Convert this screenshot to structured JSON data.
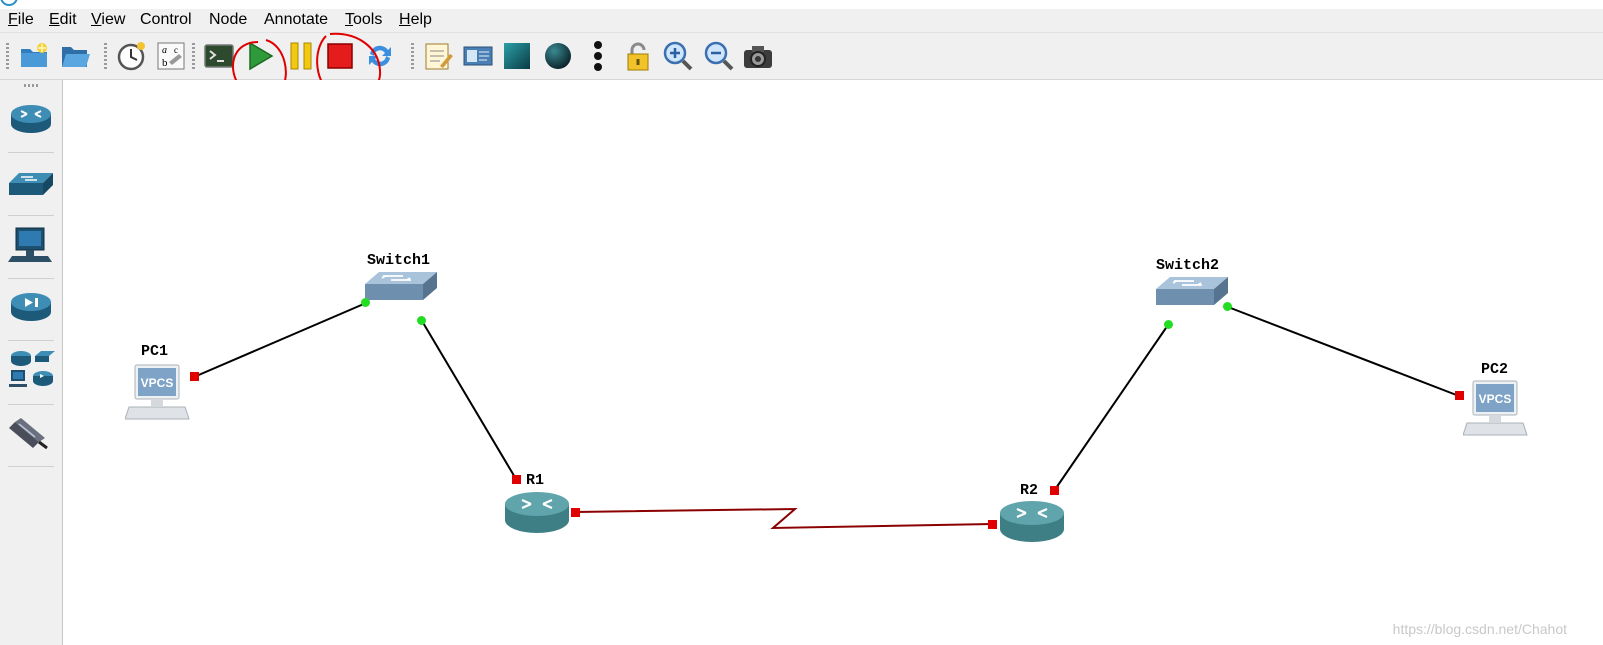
{
  "menubar": {
    "items": [
      {
        "label": "File",
        "accel": "F",
        "rest": "ile"
      },
      {
        "label": "Edit",
        "accel": "E",
        "rest": "dit"
      },
      {
        "label": "View",
        "accel": "V",
        "rest": "iew"
      },
      {
        "label": "Control",
        "accel": "",
        "rest": "Control"
      },
      {
        "label": "Node",
        "accel": "",
        "rest": "Node"
      },
      {
        "label": "Annotate",
        "accel": "",
        "rest": "Annotate"
      },
      {
        "label": "Tools",
        "accel": "T",
        "rest": "ools"
      },
      {
        "label": "Help",
        "accel": "H",
        "rest": "elp"
      }
    ]
  },
  "toolbar": {
    "buttons": [
      {
        "name": "new-project-button",
        "icon": "new-folder-icon"
      },
      {
        "name": "open-project-button",
        "icon": "open-folder-icon"
      },
      {
        "name": "snapshot-button",
        "icon": "clock-icon"
      },
      {
        "name": "show-interface-labels-button",
        "icon": "interface-labels-icon"
      },
      {
        "name": "console-all-button",
        "icon": "terminal-icon"
      },
      {
        "name": "start-all-button",
        "icon": "play-icon"
      },
      {
        "name": "suspend-all-button",
        "icon": "pause-icon"
      },
      {
        "name": "stop-all-button",
        "icon": "stop-icon"
      },
      {
        "name": "reload-all-button",
        "icon": "reload-icon"
      },
      {
        "name": "add-note-button",
        "icon": "note-icon"
      },
      {
        "name": "insert-picture-button",
        "icon": "picture-icon"
      },
      {
        "name": "draw-rectangle-button",
        "icon": "rectangle-icon"
      },
      {
        "name": "draw-ellipse-button",
        "icon": "ellipse-icon"
      },
      {
        "name": "more-options-button",
        "icon": "vertical-dots-icon"
      },
      {
        "name": "lock-items-button",
        "icon": "lock-icon"
      },
      {
        "name": "zoom-in-button",
        "icon": "zoom-in-icon"
      },
      {
        "name": "zoom-out-button",
        "icon": "zoom-out-icon"
      },
      {
        "name": "screenshot-button",
        "icon": "camera-icon"
      }
    ],
    "highlight_color": "#e00000"
  },
  "device_panel": {
    "items": [
      {
        "name": "routers",
        "icon": "router-icon"
      },
      {
        "name": "switches",
        "icon": "switch-icon"
      },
      {
        "name": "end-devices",
        "icon": "computer-icon"
      },
      {
        "name": "security-devices",
        "icon": "firewall-icon"
      },
      {
        "name": "all-devices",
        "icon": "all-devices-icon"
      },
      {
        "name": "add-link",
        "icon": "cable-icon"
      }
    ]
  },
  "topology": {
    "nodes": [
      {
        "id": "PC1",
        "label": "PC1",
        "type": "vpcs",
        "badge": "VPCS"
      },
      {
        "id": "Switch1",
        "label": "Switch1",
        "type": "switch"
      },
      {
        "id": "R1",
        "label": "R1",
        "type": "router"
      },
      {
        "id": "R2",
        "label": "R2",
        "type": "router"
      },
      {
        "id": "Switch2",
        "label": "Switch2",
        "type": "switch"
      },
      {
        "id": "PC2",
        "label": "PC2",
        "type": "vpcs",
        "badge": "VPCS"
      }
    ],
    "links": [
      {
        "from": "PC1",
        "to": "Switch1",
        "type": "ethernet",
        "from_status": "down",
        "to_status": "up"
      },
      {
        "from": "Switch1",
        "to": "R1",
        "type": "ethernet",
        "from_status": "up",
        "to_status": "down"
      },
      {
        "from": "R1",
        "to": "R2",
        "type": "serial",
        "from_status": "down",
        "to_status": "down"
      },
      {
        "from": "R2",
        "to": "Switch2",
        "type": "ethernet",
        "from_status": "down",
        "to_status": "up"
      },
      {
        "from": "Switch2",
        "to": "PC2",
        "type": "ethernet",
        "from_status": "up",
        "to_status": "down"
      }
    ],
    "colors": {
      "port_up": "#22dd22",
      "port_down": "#e00000",
      "ethernet_link": "#000000",
      "serial_link": "#8b0000"
    }
  },
  "watermark": "https://blog.csdn.net/Chahot"
}
